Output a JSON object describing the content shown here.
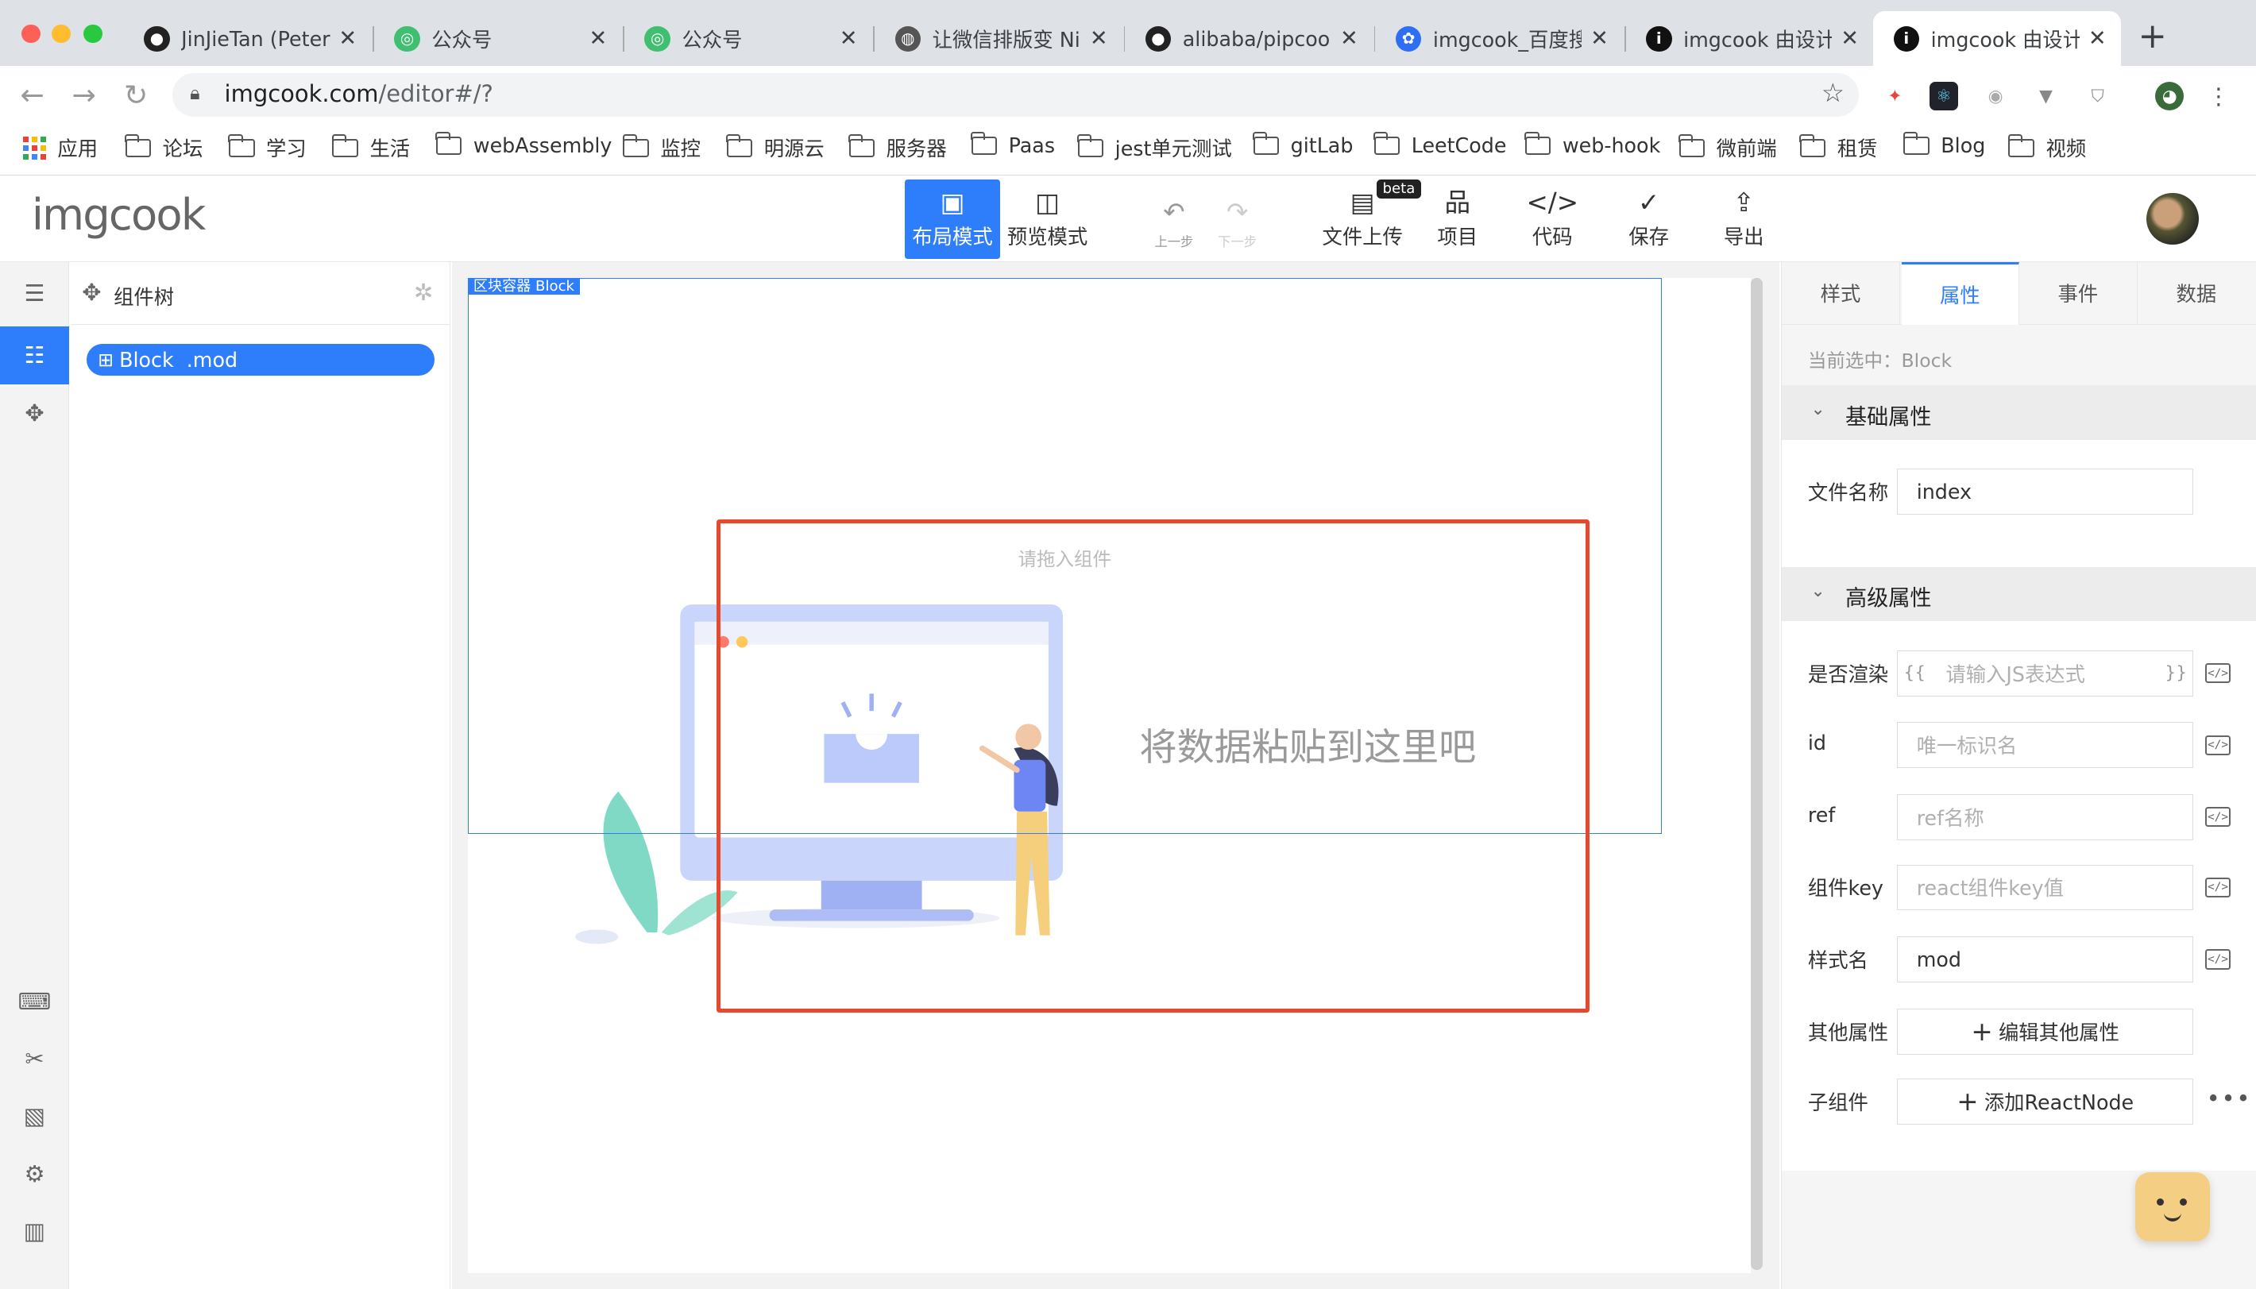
{
  "browser": {
    "tabs": [
      {
        "title": "JinJieTan (Peter)",
        "icon": "github-icon"
      },
      {
        "title": "公众号",
        "icon": "wechat-icon"
      },
      {
        "title": "公众号",
        "icon": "wechat-icon"
      },
      {
        "title": "让微信排版变 Nic",
        "icon": "globe-icon"
      },
      {
        "title": "alibaba/pipcook",
        "icon": "github-icon"
      },
      {
        "title": "imgcook_百度搜",
        "icon": "baidu-icon"
      },
      {
        "title": "imgcook 由设计",
        "icon": "info-icon"
      },
      {
        "title": "imgcook 由设计",
        "icon": "info-icon"
      }
    ],
    "close_glyph": "✕",
    "new_tab": "+",
    "url_host": "imgcook.com",
    "url_path": "/editor#/?"
  },
  "bookmarks": [
    "应用",
    "论坛",
    "学习",
    "生活",
    "webAssembly",
    "监控",
    "明源云",
    "服务器",
    "Paas",
    "jest单元测试",
    "gitLab",
    "LeetCode",
    "web-hook",
    "微前端",
    "租赁",
    "Blog",
    "视频"
  ],
  "app": {
    "logo": "imgcook",
    "toolbar": {
      "layout_mode": "布局模式",
      "preview_mode": "预览模式",
      "undo": "上一步",
      "redo": "下一步",
      "upload": "文件上传",
      "beta": "beta",
      "project": "项目",
      "code": "代码",
      "save": "保存",
      "export": "导出"
    }
  },
  "tree": {
    "title": "组件树",
    "node": "Block  .mod"
  },
  "canvas": {
    "block_label": "区块容器 Block",
    "drop_hint": "请拖入组件",
    "paste_hint": "将数据粘贴到这里吧"
  },
  "props": {
    "tabs": [
      "样式",
      "属性",
      "事件",
      "数据"
    ],
    "current": "当前选中：Block",
    "basic_title": "基础属性",
    "advanced_title": "高级属性",
    "filename_label": "文件名称",
    "filename_value": "index",
    "render_label": "是否渲染",
    "render_placeholder": "请输入JS表达式",
    "id_label": "id",
    "id_placeholder": "唯一标识名",
    "ref_label": "ref",
    "ref_placeholder": "ref名称",
    "key_label": "组件key",
    "key_placeholder": "react组件key值",
    "class_label": "样式名",
    "class_value": "mod",
    "other_label": "其他属性",
    "other_button": "编辑其他属性",
    "child_label": "子组件",
    "child_button": "添加ReactNode"
  },
  "colors": {
    "accent": "#2e7dfb",
    "annotation_red": "#e64a2e"
  }
}
